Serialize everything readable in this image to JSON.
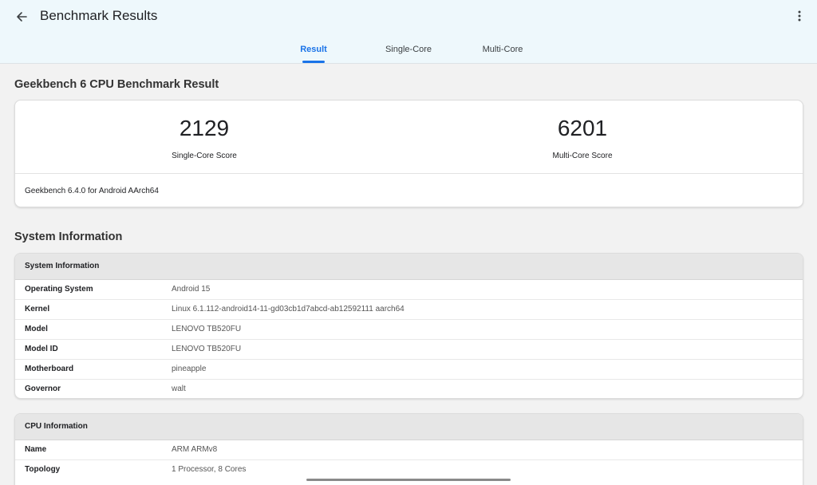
{
  "header": {
    "title": "Benchmark Results"
  },
  "tabs": [
    {
      "label": "Result",
      "active": true
    },
    {
      "label": "Single-Core",
      "active": false
    },
    {
      "label": "Multi-Core",
      "active": false
    }
  ],
  "result": {
    "title": "Geekbench 6 CPU Benchmark Result",
    "single_core": {
      "value": "2129",
      "label": "Single-Core Score"
    },
    "multi_core": {
      "value": "6201",
      "label": "Multi-Core Score"
    },
    "version": "Geekbench 6.4.0 for Android AArch64"
  },
  "system": {
    "section_title": "System Information",
    "table_title": "System Information",
    "rows": [
      {
        "key": "Operating System",
        "value": "Android 15"
      },
      {
        "key": "Kernel",
        "value": "Linux 6.1.112-android14-11-gd03cb1d7abcd-ab12592111 aarch64"
      },
      {
        "key": "Model",
        "value": "LENOVO TB520FU"
      },
      {
        "key": "Model ID",
        "value": "LENOVO TB520FU"
      },
      {
        "key": "Motherboard",
        "value": "pineapple"
      },
      {
        "key": "Governor",
        "value": "walt"
      }
    ]
  },
  "cpu": {
    "table_title": "CPU Information",
    "rows": [
      {
        "key": "Name",
        "value": "ARM ARMv8"
      },
      {
        "key": "Topology",
        "value": "1 Processor, 8 Cores"
      }
    ]
  },
  "icons": {
    "back": "arrow-left-icon",
    "menu": "more-vert-icon"
  },
  "colors": {
    "accent": "#1a73e8",
    "appbar_bg": "#eef8fc",
    "page_bg": "#f2f2f2"
  }
}
